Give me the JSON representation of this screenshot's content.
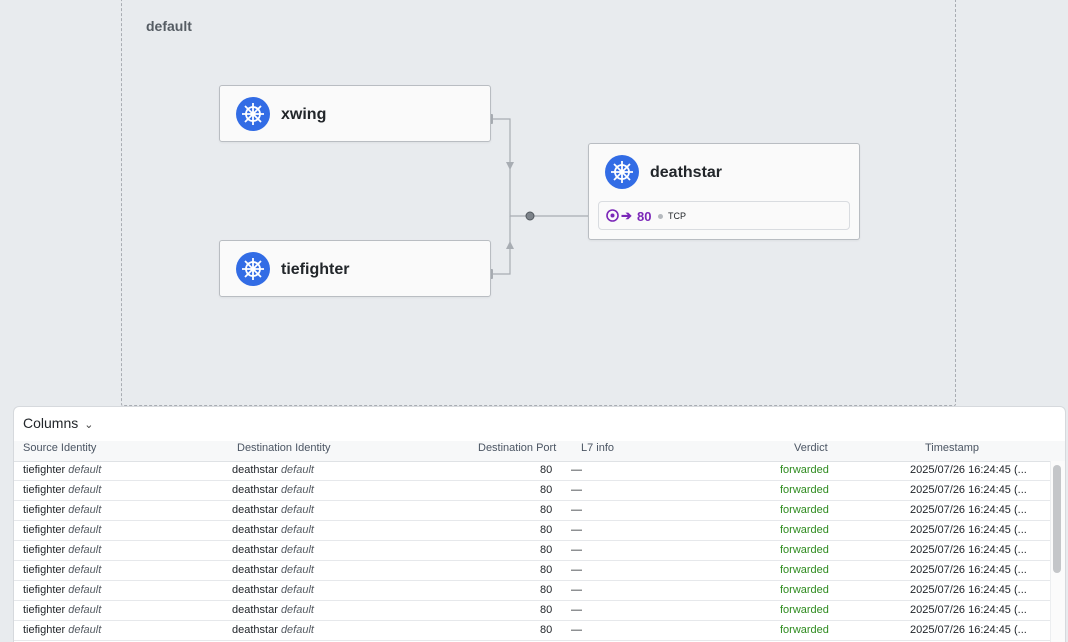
{
  "namespace": {
    "label": "default"
  },
  "services": {
    "xwing": {
      "name": "xwing",
      "icon": "kubernetes-icon"
    },
    "tiefighter": {
      "name": "tiefighter",
      "icon": "kubernetes-icon"
    },
    "deathstar": {
      "name": "deathstar",
      "icon": "kubernetes-icon",
      "port": {
        "arrow": "➔",
        "number": "80",
        "protocol": "TCP"
      }
    }
  },
  "colors": {
    "kubernetes_blue": "#326ce5",
    "port_purple": "#7b27b8",
    "forwarded_green": "#2e8b1f"
  },
  "flows": {
    "columns_label": "Columns",
    "headers": {
      "source": "Source Identity",
      "destination": "Destination Identity",
      "port": "Destination Port",
      "l7": "L7 info",
      "verdict": "Verdict",
      "timestamp": "Timestamp"
    },
    "rows": [
      {
        "src": "tiefighter",
        "src_ns": "default",
        "dst": "deathstar",
        "dst_ns": "default",
        "port": "80",
        "l7": "—",
        "verdict": "forwarded",
        "timestamp": "2025/07/26 16:24:45 (..."
      },
      {
        "src": "tiefighter",
        "src_ns": "default",
        "dst": "deathstar",
        "dst_ns": "default",
        "port": "80",
        "l7": "—",
        "verdict": "forwarded",
        "timestamp": "2025/07/26 16:24:45 (..."
      },
      {
        "src": "tiefighter",
        "src_ns": "default",
        "dst": "deathstar",
        "dst_ns": "default",
        "port": "80",
        "l7": "—",
        "verdict": "forwarded",
        "timestamp": "2025/07/26 16:24:45 (..."
      },
      {
        "src": "tiefighter",
        "src_ns": "default",
        "dst": "deathstar",
        "dst_ns": "default",
        "port": "80",
        "l7": "—",
        "verdict": "forwarded",
        "timestamp": "2025/07/26 16:24:45 (..."
      },
      {
        "src": "tiefighter",
        "src_ns": "default",
        "dst": "deathstar",
        "dst_ns": "default",
        "port": "80",
        "l7": "—",
        "verdict": "forwarded",
        "timestamp": "2025/07/26 16:24:45 (..."
      },
      {
        "src": "tiefighter",
        "src_ns": "default",
        "dst": "deathstar",
        "dst_ns": "default",
        "port": "80",
        "l7": "—",
        "verdict": "forwarded",
        "timestamp": "2025/07/26 16:24:45 (..."
      },
      {
        "src": "tiefighter",
        "src_ns": "default",
        "dst": "deathstar",
        "dst_ns": "default",
        "port": "80",
        "l7": "—",
        "verdict": "forwarded",
        "timestamp": "2025/07/26 16:24:45 (..."
      },
      {
        "src": "tiefighter",
        "src_ns": "default",
        "dst": "deathstar",
        "dst_ns": "default",
        "port": "80",
        "l7": "—",
        "verdict": "forwarded",
        "timestamp": "2025/07/26 16:24:45 (..."
      },
      {
        "src": "tiefighter",
        "src_ns": "default",
        "dst": "deathstar",
        "dst_ns": "default",
        "port": "80",
        "l7": "—",
        "verdict": "forwarded",
        "timestamp": "2025/07/26 16:24:45 (..."
      }
    ]
  }
}
